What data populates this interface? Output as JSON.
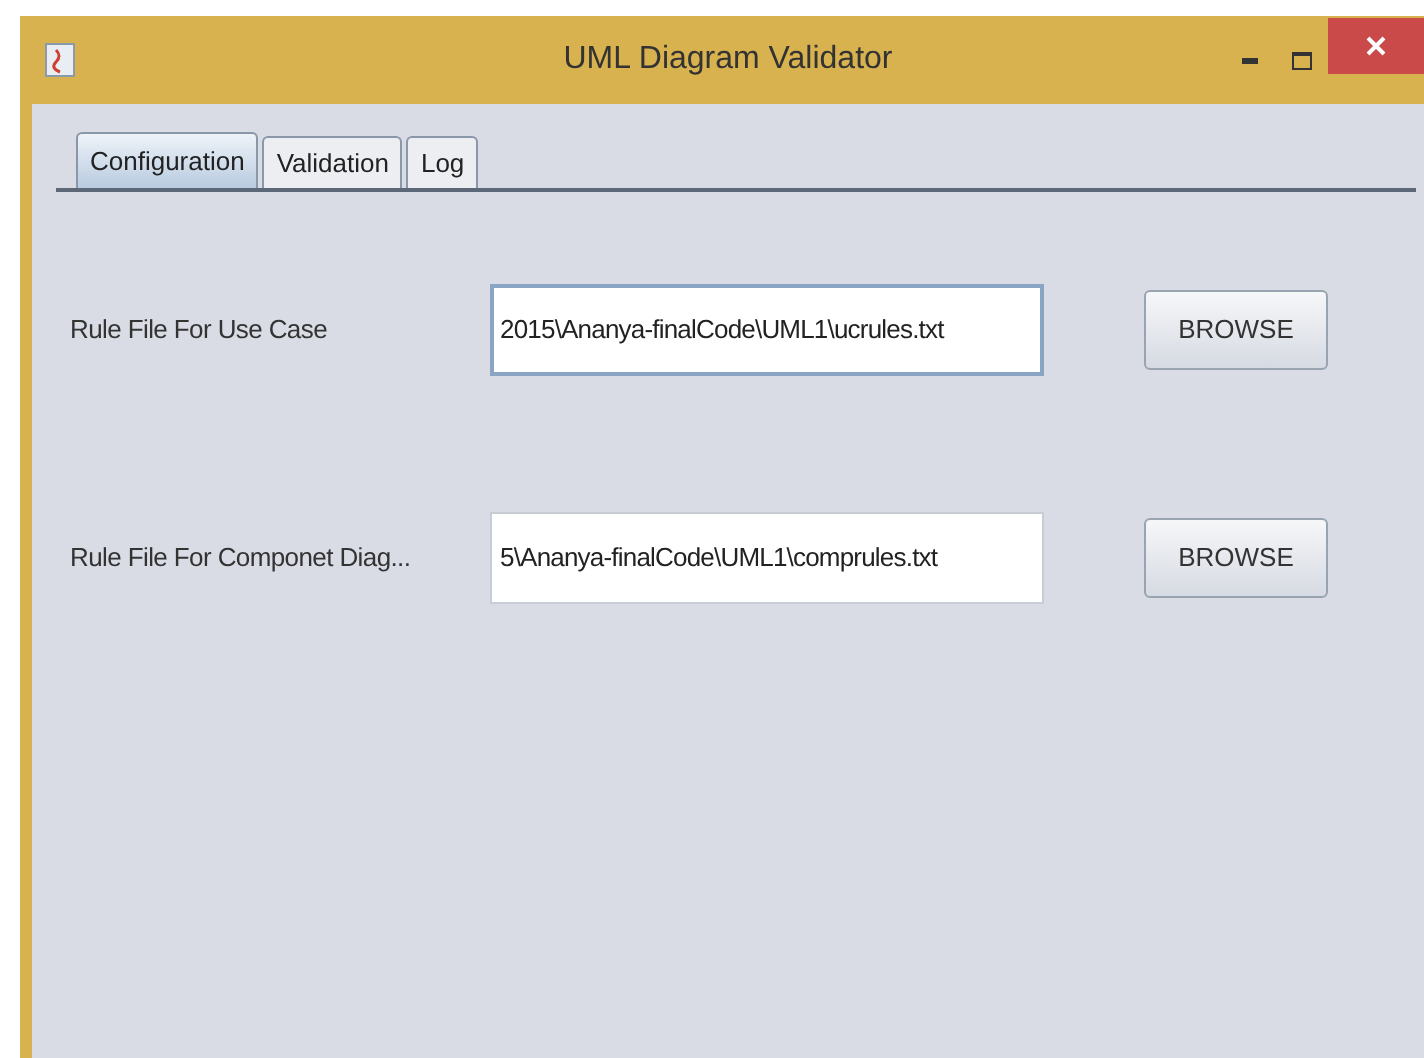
{
  "window": {
    "title": "UML Diagram Validator"
  },
  "tabs": [
    {
      "label": "Configuration",
      "selected": true
    },
    {
      "label": "Validation",
      "selected": false
    },
    {
      "label": "Log",
      "selected": false
    }
  ],
  "rows": [
    {
      "label": "Rule File For Use Case",
      "value": "2015\\Ananya-finalCode\\UML1\\ucrules.txt",
      "focused": true,
      "button": "BROWSE"
    },
    {
      "label": "Rule File For Componet Diag...",
      "value": "5\\Ananya-finalCode\\UML1\\comprules.txt",
      "focused": false,
      "button": "BROWSE"
    }
  ]
}
